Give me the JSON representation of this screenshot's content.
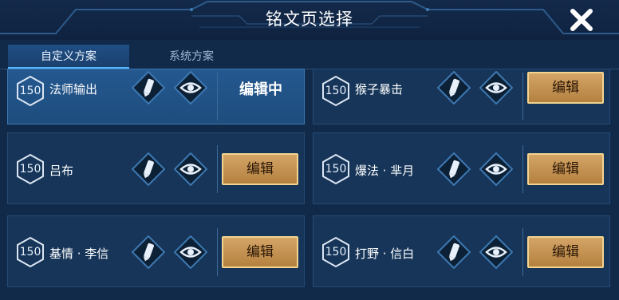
{
  "header": {
    "title": "铭文页选择",
    "close_icon": "close-icon"
  },
  "tabs": [
    {
      "label": "自定义方案",
      "active": true
    },
    {
      "label": "系统方案",
      "active": false
    }
  ],
  "colors": {
    "accent_blue": "#57b6ff",
    "edit_button_gold": "#c9954f",
    "panel_blue": "#163559"
  },
  "pages": [
    {
      "level": "150",
      "name": "法师输出",
      "status": "编辑中",
      "active": true
    },
    {
      "level": "150",
      "name": "猴子暴击",
      "edit_label": "编辑",
      "active": false
    },
    {
      "level": "150",
      "name": "吕布",
      "edit_label": "编辑",
      "active": false
    },
    {
      "level": "150",
      "name": "爆法 · 芈月",
      "edit_label": "编辑",
      "active": false
    },
    {
      "level": "150",
      "name": "基情 · 李信",
      "edit_label": "编辑",
      "active": false
    },
    {
      "level": "150",
      "name": "打野 · 信白",
      "edit_label": "编辑",
      "active": false
    }
  ],
  "card_icons": [
    "level-badge-icon",
    "pencil-icon",
    "eye-icon"
  ]
}
